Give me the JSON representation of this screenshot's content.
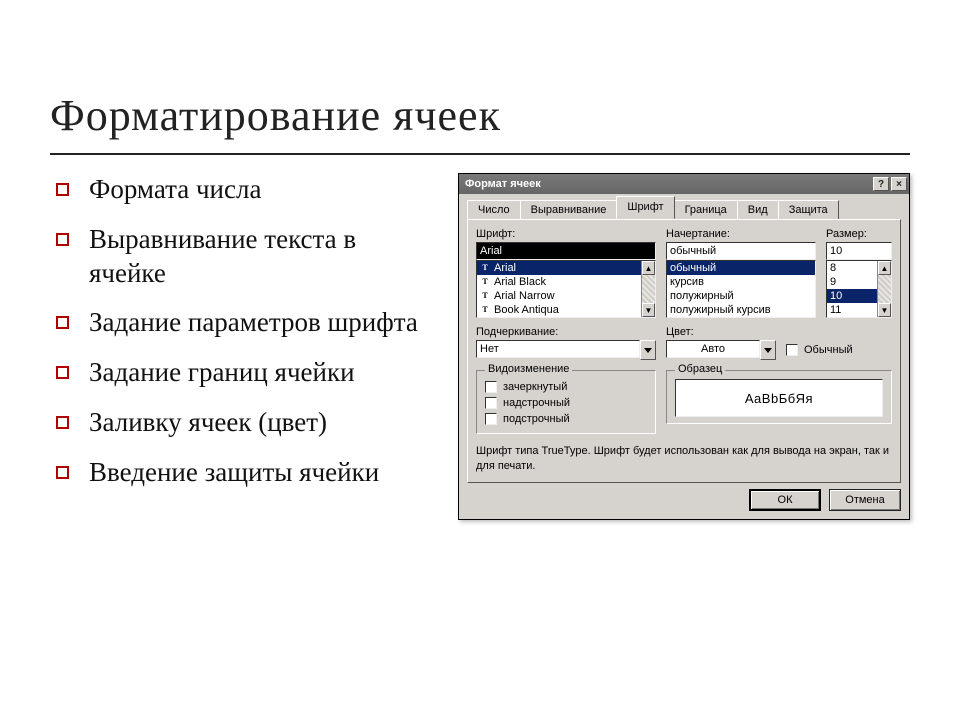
{
  "slide": {
    "title": "Форматирование ячеек",
    "bullets": [
      "Формата числа",
      "Выравнивание текста в ячейке",
      "Задание параметров шрифта",
      "Задание границ ячейки",
      "Заливку ячеек (цвет)",
      "Введение защиты ячейки"
    ]
  },
  "dialog": {
    "title": "Формат ячеек",
    "help_glyph": "?",
    "close_glyph": "×",
    "tabs": [
      "Число",
      "Выравнивание",
      "Шрифт",
      "Граница",
      "Вид",
      "Защита"
    ],
    "active_tab": 2,
    "labels": {
      "font": "Шрифт:",
      "style": "Начертание:",
      "size": "Размер:",
      "underline": "Подчеркивание:",
      "color": "Цвет:",
      "normal": "Обычный",
      "effects": "Видоизменение",
      "sample": "Образец"
    },
    "font": {
      "value": "Arial",
      "list": [
        "Arial",
        "Arial Black",
        "Arial Narrow",
        "Book Antiqua"
      ],
      "selected_index": 0
    },
    "style": {
      "value": "обычный",
      "list": [
        "обычный",
        "курсив",
        "полужирный",
        "полужирный курсив"
      ],
      "selected_index": 0
    },
    "size": {
      "value": "10",
      "list": [
        "8",
        "9",
        "10",
        "11"
      ],
      "selected_index": 2
    },
    "underline": {
      "value": "Нет"
    },
    "color": {
      "value": "Авто"
    },
    "normal_checked": false,
    "effects": {
      "strike": {
        "label": "зачеркнутый",
        "checked": false
      },
      "superscript": {
        "label": "надстрочный",
        "checked": false
      },
      "subscript": {
        "label": "подстрочный",
        "checked": false
      }
    },
    "sample_text": "AaBbБбЯя",
    "hint": "Шрифт типа TrueType. Шрифт будет использован как для вывода на экран, так и для печати.",
    "buttons": {
      "ok": "ОК",
      "cancel": "Отмена"
    }
  }
}
